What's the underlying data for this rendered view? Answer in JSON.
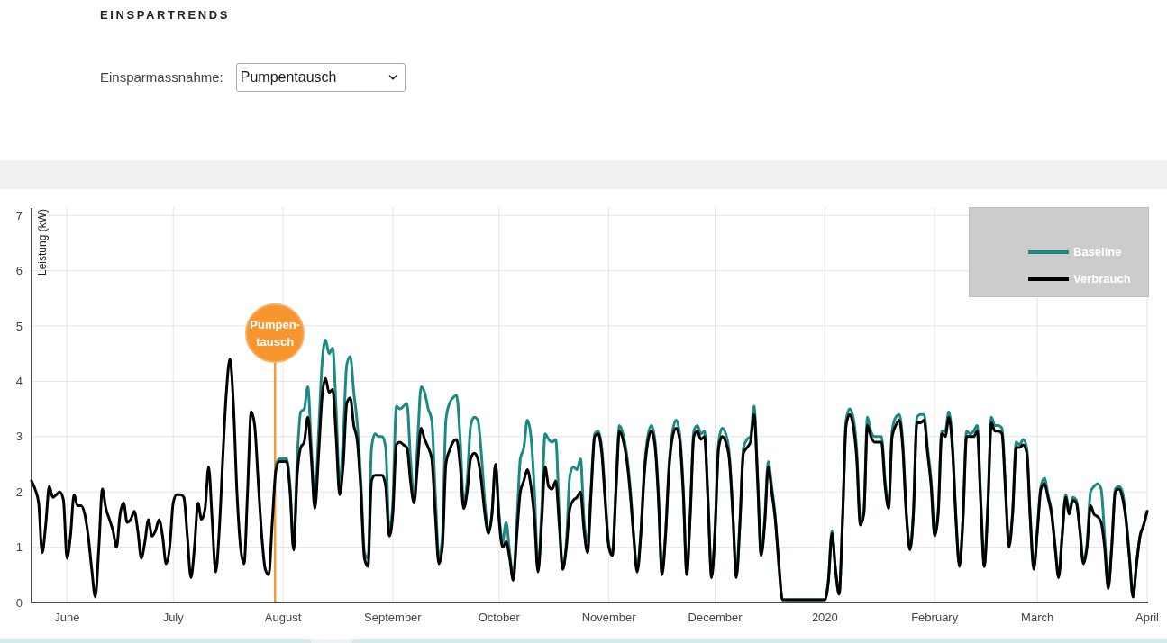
{
  "section": {
    "title": "EINSPARTRENDS"
  },
  "filter": {
    "label": "Einsparmassnahme:",
    "value": "Pumpentausch"
  },
  "chart": {
    "chart_data": {
      "type": "line",
      "ylabel": "Leistung (kW)",
      "grid": true,
      "legend": "upper right",
      "ylim": [
        0,
        7.15
      ],
      "yticks": [
        0,
        1,
        2,
        3,
        4,
        5,
        6,
        7
      ],
      "categories": [
        null,
        null,
        null,
        null,
        null,
        null,
        null,
        null,
        null,
        null,
        "June",
        null,
        null,
        null,
        null,
        null,
        null,
        null,
        null,
        null,
        null,
        null,
        null,
        null,
        null,
        null,
        null,
        null,
        null,
        null,
        null,
        null,
        null,
        null,
        null,
        null,
        null,
        null,
        null,
        null,
        "July",
        null,
        null,
        null,
        null,
        null,
        null,
        null,
        null,
        null,
        null,
        null,
        null,
        null,
        null,
        null,
        null,
        null,
        null,
        null,
        null,
        null,
        null,
        null,
        null,
        null,
        null,
        null,
        null,
        null,
        null,
        "August",
        null,
        null,
        null,
        null,
        null,
        null,
        null,
        null,
        null,
        null,
        null,
        null,
        null,
        null,
        null,
        null,
        null,
        null,
        null,
        null,
        null,
        null,
        null,
        null,
        null,
        null,
        null,
        null,
        null,
        null,
        "September",
        null,
        null,
        null,
        null,
        null,
        null,
        null,
        null,
        null,
        null,
        null,
        null,
        null,
        null,
        null,
        null,
        null,
        null,
        null,
        null,
        null,
        null,
        null,
        null,
        null,
        null,
        null,
        null,
        null,
        "October",
        null,
        null,
        null,
        null,
        null,
        null,
        null,
        null,
        null,
        null,
        null,
        null,
        null,
        null,
        null,
        null,
        null,
        null,
        null,
        null,
        null,
        null,
        null,
        null,
        null,
        null,
        null,
        null,
        null,
        null,
        "November",
        null,
        null,
        null,
        null,
        null,
        null,
        null,
        null,
        null,
        null,
        null,
        null,
        null,
        null,
        null,
        null,
        null,
        null,
        null,
        null,
        null,
        null,
        null,
        null,
        null,
        null,
        null,
        null,
        null,
        "December",
        null,
        null,
        null,
        null,
        null,
        null,
        null,
        null,
        null,
        null,
        null,
        null,
        null,
        null,
        null,
        null,
        null,
        null,
        null,
        null,
        null,
        null,
        null,
        null,
        null,
        null,
        null,
        null,
        null,
        null,
        "2020",
        null,
        null,
        null,
        null,
        null,
        null,
        null,
        null,
        null,
        null,
        null,
        null,
        null,
        null,
        null,
        null,
        null,
        null,
        null,
        null,
        null,
        null,
        null,
        null,
        null,
        null,
        null,
        null,
        null,
        null,
        "February",
        null,
        null,
        null,
        null,
        null,
        null,
        null,
        null,
        null,
        null,
        null,
        null,
        null,
        null,
        null,
        null,
        null,
        null,
        null,
        null,
        null,
        null,
        null,
        null,
        null,
        null,
        null,
        null,
        "March",
        null,
        null,
        null,
        null,
        null,
        null,
        null,
        null,
        null,
        null,
        null,
        null,
        null,
        null,
        null,
        null,
        null,
        null,
        null,
        null,
        null,
        null,
        null,
        null,
        null,
        null,
        null,
        null,
        null,
        null,
        "April"
      ],
      "series": [
        {
          "name": "Baseline",
          "color": "#1b8a84",
          "values": [
            null,
            null,
            null,
            null,
            null,
            null,
            null,
            null,
            null,
            null,
            null,
            null,
            null,
            null,
            null,
            null,
            null,
            null,
            null,
            null,
            null,
            null,
            null,
            null,
            null,
            null,
            null,
            null,
            null,
            null,
            null,
            null,
            null,
            null,
            null,
            null,
            null,
            null,
            null,
            null,
            null,
            null,
            null,
            null,
            null,
            null,
            null,
            null,
            null,
            null,
            null,
            null,
            null,
            null,
            null,
            null,
            null,
            null,
            null,
            null,
            null,
            null,
            null,
            null,
            null,
            null,
            null,
            null,
            null,
            2.5,
            2.6,
            2.6,
            2.6,
            2.1,
            1.0,
            2.6,
            3.45,
            3.5,
            3.9,
            2.8,
            1.8,
            3.0,
            4.3,
            4.75,
            4.5,
            4.6,
            3.5,
            2.1,
            3.0,
            4.3,
            4.45,
            3.8,
            3.2,
            2.2,
            0.9,
            0.8,
            2.8,
            3.05,
            3.0,
            3.0,
            2.8,
            1.3,
            1.8,
            3.55,
            3.5,
            3.55,
            3.6,
            2.6,
            1.9,
            2.9,
            3.9,
            3.8,
            3.5,
            3.3,
            2.0,
            0.8,
            1.2,
            3.3,
            3.6,
            3.7,
            3.75,
            3.0,
            1.8,
            2.2,
            3.2,
            3.35,
            3.3,
            2.7,
            1.8,
            1.3,
            1.6,
            2.5,
            1.6,
            1.1,
            1.45,
            0.9,
            0.45,
            1.4,
            2.6,
            2.8,
            3.3,
            3.0,
            2.0,
            0.6,
            1.6,
            3.05,
            2.95,
            2.9,
            2.95,
            1.6,
            0.6,
            1.1,
            2.3,
            2.45,
            2.4,
            2.6,
            1.5,
            1.1,
            2.1,
            3.05,
            3.1,
            2.8,
            1.9,
            1.05,
            0.9,
            2.1,
            3.2,
            3.05,
            2.7,
            2.1,
            1.25,
            0.6,
            1.25,
            2.4,
            3.0,
            3.2,
            2.95,
            2.0,
            0.55,
            1.25,
            2.5,
            3.1,
            3.3,
            3.05,
            2.1,
            0.55,
            1.65,
            3.1,
            3.2,
            3.05,
            3.1,
            1.9,
            0.5,
            1.35,
            2.9,
            3.15,
            3.05,
            2.7,
            1.65,
            0.5,
            1.45,
            2.8,
            2.95,
            3.0,
            3.55,
            2.3,
            0.9,
            1.5,
            2.55,
            2.1,
            1.55,
            0.65,
            0.05,
            0.05,
            0.05,
            0.05,
            0.05,
            0.05,
            0.05,
            0.05,
            0.05,
            0.05,
            0.05,
            0.05,
            0.05,
            0.4,
            1.3,
            0.6,
            0.15,
            1.55,
            3.3,
            3.5,
            3.35,
            2.75,
            1.5,
            1.65,
            3.35,
            3.1,
            3.0,
            3.0,
            3.0,
            2.2,
            1.75,
            3.1,
            3.35,
            3.4,
            2.9,
            1.65,
            1.0,
            1.65,
            3.35,
            3.4,
            3.4,
            2.8,
            2.2,
            1.25,
            1.65,
            3.1,
            3.1,
            3.45,
            2.9,
            1.55,
            0.7,
            1.55,
            3.1,
            3.05,
            3.1,
            3.2,
            1.9,
            0.7,
            1.75,
            3.35,
            3.2,
            3.2,
            3.15,
            2.1,
            1.05,
            1.65,
            2.9,
            2.85,
            2.95,
            2.8,
            1.55,
            0.65,
            1.35,
            2.1,
            2.25,
            1.95,
            1.65,
            1.05,
            0.5,
            1.25,
            1.95,
            1.65,
            1.9,
            1.85,
            1.35,
            0.75,
            1.05,
            2.0,
            2.1,
            2.15,
            2.05,
            1.2,
            0.3,
            1.05,
            2.05,
            2.1,
            2.0,
            1.55,
            0.85,
            0.1,
            0.7,
            1.2,
            1.4,
            1.65
          ]
        },
        {
          "name": "Verbrauch",
          "color": "#000000",
          "values": [
            2.2,
            2.05,
            1.8,
            0.9,
            1.4,
            2.1,
            1.9,
            1.95,
            2.0,
            1.85,
            0.8,
            1.2,
            1.95,
            1.75,
            1.75,
            1.6,
            1.2,
            0.6,
            0.1,
            1.0,
            2.05,
            1.7,
            1.5,
            1.3,
            1.0,
            1.6,
            1.8,
            1.45,
            1.5,
            1.65,
            1.3,
            0.8,
            1.1,
            1.5,
            1.2,
            1.3,
            1.5,
            1.2,
            0.7,
            1.0,
            1.8,
            1.95,
            1.95,
            1.9,
            1.2,
            0.45,
            1.0,
            1.8,
            1.5,
            1.7,
            2.45,
            1.5,
            0.55,
            1.3,
            2.6,
            3.8,
            4.4,
            3.6,
            2.0,
            1.0,
            0.7,
            2.0,
            3.45,
            3.2,
            2.2,
            1.2,
            0.6,
            0.5,
            1.5,
            2.4,
            2.55,
            2.55,
            2.55,
            2.0,
            0.95,
            2.3,
            2.8,
            2.9,
            3.35,
            2.6,
            1.7,
            2.6,
            3.7,
            4.05,
            3.8,
            3.85,
            3.0,
            1.95,
            2.5,
            3.6,
            3.7,
            3.2,
            2.9,
            2.0,
            0.8,
            0.65,
            2.2,
            2.3,
            2.3,
            2.3,
            2.1,
            1.2,
            1.6,
            2.85,
            2.9,
            2.85,
            2.8,
            2.2,
            1.8,
            2.5,
            3.15,
            2.95,
            2.8,
            2.6,
            1.6,
            0.7,
            1.0,
            2.5,
            2.75,
            2.9,
            2.95,
            2.5,
            1.7,
            2.0,
            2.6,
            2.7,
            2.6,
            2.2,
            1.6,
            1.25,
            1.6,
            2.5,
            1.5,
            1.0,
            1.1,
            0.8,
            0.4,
            1.2,
            2.0,
            2.2,
            2.4,
            2.1,
            1.5,
            0.55,
            1.4,
            2.45,
            2.1,
            2.05,
            2.2,
            1.4,
            0.6,
            1.0,
            1.7,
            1.85,
            1.9,
            2.0,
            1.3,
            0.9,
            2.0,
            3.0,
            3.05,
            2.7,
            1.8,
            1.0,
            0.85,
            2.0,
            3.1,
            2.95,
            2.6,
            2.0,
            1.2,
            0.55,
            1.2,
            2.3,
            2.9,
            3.1,
            2.85,
            1.9,
            0.5,
            1.2,
            2.4,
            3.0,
            3.15,
            2.95,
            2.0,
            0.5,
            1.6,
            3.0,
            3.1,
            2.95,
            3.0,
            1.8,
            0.45,
            1.3,
            2.8,
            3.0,
            2.9,
            2.6,
            1.6,
            0.45,
            1.4,
            2.7,
            2.8,
            2.9,
            3.4,
            2.2,
            0.85,
            1.4,
            2.45,
            2.0,
            1.5,
            0.7,
            0.05,
            0.05,
            0.05,
            0.05,
            0.05,
            0.05,
            0.05,
            0.05,
            0.05,
            0.05,
            0.05,
            0.05,
            0.05,
            0.4,
            1.25,
            0.6,
            0.15,
            1.5,
            3.2,
            3.4,
            3.2,
            2.6,
            1.4,
            1.6,
            3.2,
            3.0,
            2.9,
            2.9,
            2.9,
            2.1,
            1.7,
            3.0,
            3.2,
            3.3,
            2.8,
            1.6,
            0.95,
            1.6,
            3.25,
            3.25,
            3.3,
            2.7,
            2.1,
            1.2,
            1.6,
            3.05,
            3.0,
            3.35,
            2.8,
            1.5,
            0.65,
            1.5,
            3.0,
            3.0,
            3.0,
            3.1,
            1.8,
            0.65,
            1.7,
            3.25,
            3.1,
            3.1,
            3.05,
            2.0,
            1.0,
            1.6,
            2.8,
            2.8,
            2.85,
            2.7,
            1.5,
            0.6,
            1.3,
            2.05,
            2.15,
            1.9,
            1.6,
            1.0,
            0.45,
            1.2,
            1.9,
            1.6,
            1.85,
            1.8,
            1.3,
            0.7,
            1.0,
            1.75,
            1.6,
            1.55,
            1.45,
            1.0,
            0.25,
            1.0,
            2.0,
            2.05,
            1.9,
            1.5,
            0.8,
            0.1,
            0.7,
            1.2,
            1.4,
            1.65
          ]
        }
      ],
      "annotations": [
        {
          "text": "Pumpen-tausch"
        }
      ]
    }
  }
}
